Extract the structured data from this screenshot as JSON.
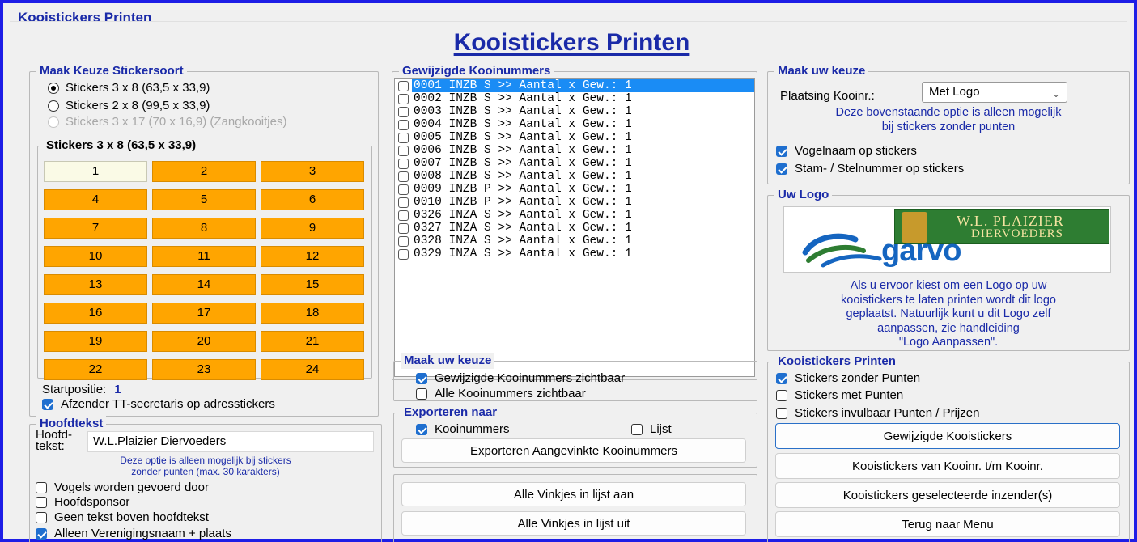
{
  "window": {
    "title": "Kooistickers Printen"
  },
  "header": {
    "title": "Kooistickers Printen"
  },
  "sticker_type": {
    "legend": "Maak Keuze Stickersoort",
    "options": [
      {
        "label": "Stickers 3 x 8 (63,5 x 33,9)",
        "selected": true,
        "enabled": true
      },
      {
        "label": "Stickers 2 x 8 (99,5 x 33,9)",
        "selected": false,
        "enabled": true
      },
      {
        "label": "Stickers 3 x 17 (70 x 16,9) (Zangkooitjes)",
        "selected": false,
        "enabled": false
      }
    ],
    "grid_legend": "Stickers 3 x 8 (63,5 x 33,9)",
    "cells": [
      "1",
      "2",
      "3",
      "4",
      "5",
      "6",
      "7",
      "8",
      "9",
      "10",
      "11",
      "12",
      "13",
      "14",
      "15",
      "16",
      "17",
      "18",
      "19",
      "20",
      "21",
      "22",
      "23",
      "24"
    ],
    "start_label": "Startpositie:",
    "start_value": "1",
    "sender_label": "Afzender TT-secretaris op adresstickers",
    "cell_color": "#ffa500",
    "first_cell_color": "#fafae6"
  },
  "headtext": {
    "legend": "Hoofdtekst",
    "field_label_1": "Hoofd-",
    "field_label_2": "tekst:",
    "value": "W.L.Plaizier Diervoeders",
    "note_1": "Deze optie is alleen mogelijk bij stickers",
    "note_2": "zonder punten (max. 30 karakters)",
    "checks": [
      {
        "label": "Vogels worden gevoerd door",
        "checked": false
      },
      {
        "label": "Hoofdsponsor",
        "checked": false
      },
      {
        "label": "Geen tekst boven hoofdtekst",
        "checked": false
      },
      {
        "label": "Alleen Verenigingsnaam + plaats",
        "checked": true
      }
    ]
  },
  "changed_numbers": {
    "legend": "Gewijzigde Kooinummers",
    "items": [
      "0001 INZB S >> Aantal x Gew.: 1",
      "0002 INZB S >> Aantal x Gew.: 1",
      "0003 INZB S >> Aantal x Gew.: 1",
      "0004 INZB S >> Aantal x Gew.: 1",
      "0005 INZB S >> Aantal x Gew.: 1",
      "0006 INZB S >> Aantal x Gew.: 1",
      "0007 INZB S >> Aantal x Gew.: 1",
      "0008 INZB S >> Aantal x Gew.: 1",
      "0009 INZB P >> Aantal x Gew.: 1",
      "0010 INZB P >> Aantal x Gew.: 1",
      "0326 INZA S >> Aantal x Gew.: 1",
      "0327 INZA S >> Aantal x Gew.: 1",
      "0328 INZA S >> Aantal x Gew.: 1",
      "0329 INZA S >> Aantal x Gew.: 1"
    ],
    "selected_index": 0
  },
  "choice_mid": {
    "legend": "Maak uw keuze",
    "checks": [
      {
        "label": "Gewijzigde Kooinummers zichtbaar",
        "checked": true
      },
      {
        "label": "Alle Kooinummers zichtbaar",
        "checked": false
      }
    ]
  },
  "export": {
    "legend": "Exporteren naar",
    "check_numbers": {
      "label": "Kooinummers",
      "checked": true
    },
    "check_list": {
      "label": "Lijst",
      "checked": false
    },
    "button": "Exporteren Aangevinkte Kooinummers"
  },
  "ticks": {
    "all_on": "Alle Vinkjes in lijst aan",
    "all_off": "Alle Vinkjes in lijst uit"
  },
  "choice_right": {
    "legend": "Maak uw keuze",
    "placement_label": "Plaatsing Kooinr.:",
    "placement_value": "Met Logo",
    "note_1": "Deze bovenstaande optie is alleen mogelijk",
    "note_2": "bij stickers zonder punten",
    "checks": [
      {
        "label": "Vogelnaam op stickers",
        "checked": true
      },
      {
        "label": "Stam- / Stelnummer op stickers",
        "checked": true
      }
    ]
  },
  "logo": {
    "legend": "Uw Logo",
    "brand_top_1": "W.L. PLAIZIER",
    "brand_top_2": "DIERVOEDERS",
    "brand_main": "garvo",
    "note_1": "Als u ervoor kiest om een Logo op uw",
    "note_2": "kooistickers te laten printen wordt dit logo",
    "note_3": "geplaatst. Natuurlijk kunt u dit Logo zelf",
    "note_4": "aanpassen, zie handleiding",
    "note_5": "\"Logo Aanpassen\".",
    "green": "#2e7d32",
    "blue": "#1565c0"
  },
  "print": {
    "legend": "Kooistickers Printen",
    "checks": [
      {
        "label": "Stickers zonder Punten",
        "checked": true
      },
      {
        "label": "Stickers met Punten",
        "checked": false
      },
      {
        "label": "Stickers invulbaar Punten / Prijzen",
        "checked": false
      }
    ],
    "buttons": [
      "Gewijzigde Kooistickers",
      "Kooistickers van Kooinr. t/m Kooinr.",
      "Kooistickers geselecteerde inzender(s)",
      "Terug naar Menu"
    ]
  },
  "colors": {
    "accent_blue": "#1a2aa8",
    "frame_blue": "#1e1ee6",
    "selection": "#1a8cf5",
    "check": "#1f6fcf"
  }
}
